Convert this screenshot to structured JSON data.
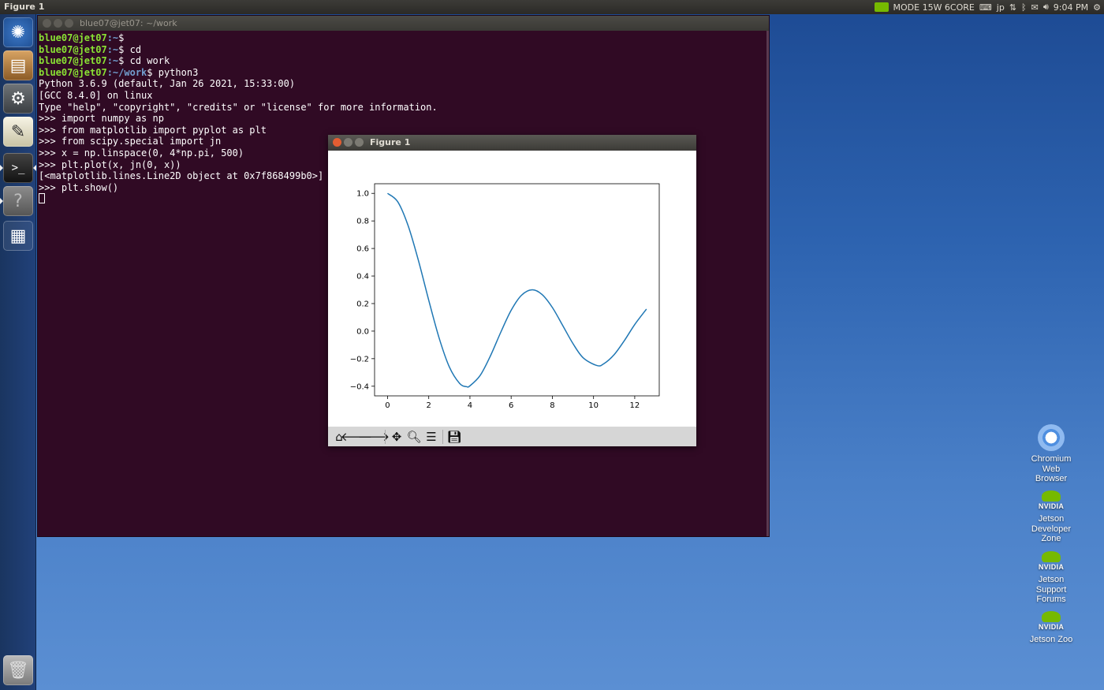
{
  "top_panel": {
    "window_title": "Figure 1",
    "power_mode": "MODE 15W 6CORE",
    "keyboard_layout": "jp",
    "clock": "9:04 PM"
  },
  "terminal": {
    "title": "blue07@jet07: ~/work",
    "lines": [
      {
        "user": "blue07@jet07",
        "path": ":~",
        "cmd": "$ "
      },
      {
        "user": "blue07@jet07",
        "path": ":~",
        "cmd": "$ cd"
      },
      {
        "user": "blue07@jet07",
        "path": ":~",
        "cmd": "$ cd work"
      },
      {
        "user": "blue07@jet07",
        "path": ":~/work",
        "cmd": "$ python3"
      },
      {
        "text": "Python 3.6.9 (default, Jan 26 2021, 15:33:00)"
      },
      {
        "text": "[GCC 8.4.0] on linux"
      },
      {
        "text": "Type \"help\", \"copyright\", \"credits\" or \"license\" for more information."
      },
      {
        "text": ">>> import numpy as np"
      },
      {
        "text": ">>> from matplotlib import pyplot as plt"
      },
      {
        "text": ">>> from scipy.special import jn"
      },
      {
        "text": ">>> x = np.linspace(0, 4*np.pi, 500)"
      },
      {
        "text": ">>> plt.plot(x, jn(0, x))"
      },
      {
        "text": "[<matplotlib.lines.Line2D object at 0x7f868499b0>]"
      },
      {
        "text": ">>> plt.show()"
      }
    ]
  },
  "figure_window": {
    "title": "Figure 1",
    "toolbar": [
      "home-icon",
      "back-icon",
      "forward-icon",
      "pan-icon",
      "zoom-icon",
      "subplots-icon",
      "save-icon"
    ]
  },
  "chart_data": {
    "type": "line",
    "title": "",
    "xlabel": "",
    "ylabel": "",
    "xlim": [
      -0.63,
      13.19
    ],
    "ylim": [
      -0.47,
      1.07
    ],
    "xticks": [
      0,
      2,
      4,
      6,
      8,
      10,
      12
    ],
    "yticks": [
      -0.4,
      -0.2,
      0.0,
      0.2,
      0.4,
      0.6,
      0.8,
      1.0
    ],
    "ytick_labels": [
      "−0.4",
      "−0.2",
      "0.0",
      "0.2",
      "0.4",
      "0.6",
      "0.8",
      "1.0"
    ],
    "line_color": "#1f77b4",
    "grid": false,
    "series": [
      {
        "x": [
          0,
          0.5,
          1,
          1.5,
          2,
          2.5,
          3,
          3.5,
          3.83,
          4,
          4.5,
          5,
          5.5,
          6,
          6.5,
          7.02,
          7.5,
          8,
          8.5,
          9,
          9.5,
          10.17,
          10.5,
          11,
          11.5,
          12,
          12.57
        ],
        "y": [
          1.0,
          0.938,
          0.765,
          0.512,
          0.224,
          -0.048,
          -0.26,
          -0.38,
          -0.403,
          -0.397,
          -0.321,
          -0.178,
          -0.007,
          0.151,
          0.26,
          0.3,
          0.266,
          0.172,
          0.042,
          -0.09,
          -0.194,
          -0.25,
          -0.237,
          -0.171,
          -0.068,
          0.048,
          0.16
        ]
      }
    ]
  },
  "desktop_icons": [
    {
      "label_lines": [
        "Chromium",
        "Web",
        "Browser"
      ]
    },
    {
      "label_lines": [
        "Jetson",
        "Developer",
        "Zone"
      ]
    },
    {
      "label_lines": [
        "Jetson",
        "Support",
        "Forums"
      ]
    },
    {
      "label_lines": [
        "Jetson Zoo"
      ]
    }
  ],
  "nvidia_wordmark": "NVIDIA",
  "colors": {
    "terminal_bg": "#300a24",
    "prompt_user": "#8ae234",
    "prompt_path": "#729fcf",
    "nvidia_green": "#76b900"
  }
}
